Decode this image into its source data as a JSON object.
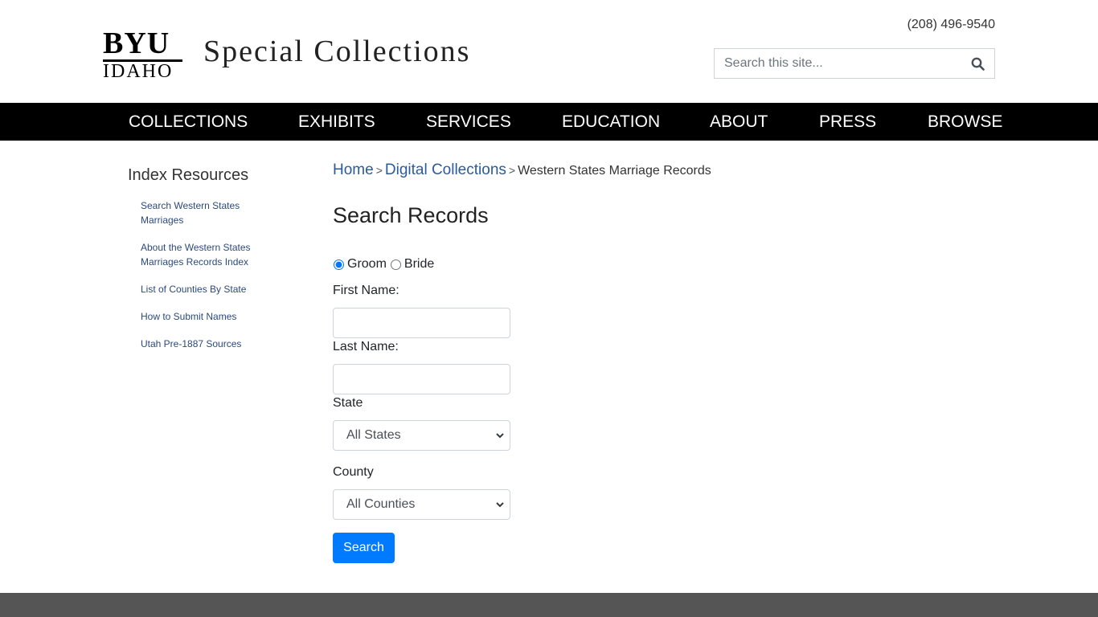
{
  "header": {
    "logo_top": "BYU",
    "logo_bottom": "IDAHO",
    "site_title": "Special Collections",
    "phone": "(208) 496-9540",
    "search_placeholder": "Search this site..."
  },
  "nav": [
    {
      "label": "COLLECTIONS"
    },
    {
      "label": "EXHIBITS"
    },
    {
      "label": "SERVICES"
    },
    {
      "label": "EDUCATION"
    },
    {
      "label": "ABOUT"
    },
    {
      "label": "PRESS"
    },
    {
      "label": "BROWSE"
    }
  ],
  "sidebar": {
    "title": "Index Resources",
    "items": [
      {
        "label": "Search Western States Marriages"
      },
      {
        "label": "About the Western States Marriages Records Index"
      },
      {
        "label": "List of Counties By State"
      },
      {
        "label": "How to Submit Names"
      },
      {
        "label": "Utah Pre-1887 Sources"
      }
    ]
  },
  "breadcrumb": {
    "home": "Home",
    "sep": ">",
    "digital": "Digital Collections",
    "current": "Western States Marriage Records"
  },
  "form": {
    "title": "Search Records",
    "radio_groom": "Groom",
    "radio_bride": "Bride",
    "first_name_label": "First Name:",
    "first_name_value": "",
    "last_name_label": "Last Name:",
    "last_name_value": "",
    "state_label": "State",
    "state_selected": "All States",
    "county_label": "County",
    "county_selected": "All Counties",
    "submit_label": "Search"
  },
  "colors": {
    "nav_bg": "#000000",
    "link": "#2b5a9b",
    "button": "#007bff",
    "footer": "#555555"
  }
}
